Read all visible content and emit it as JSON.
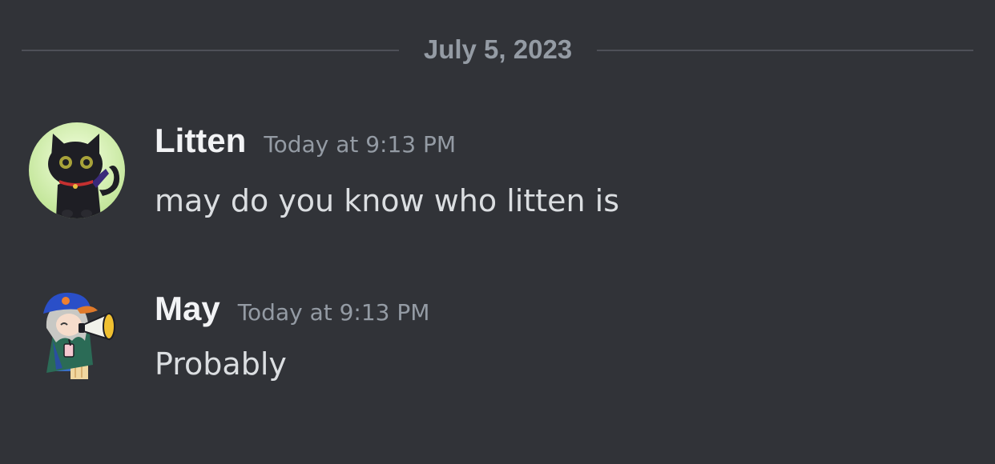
{
  "date_divider": {
    "label": "July 5, 2023"
  },
  "messages": [
    {
      "username": "Litten",
      "timestamp": "Today at 9:13 PM",
      "content": "may do you know who litten is",
      "avatar_icon": "black-cat-avatar"
    },
    {
      "username": "May",
      "timestamp": "Today at 9:13 PM",
      "content": "Probably",
      "avatar_icon": "megaphone-character-avatar"
    }
  ],
  "colors": {
    "background": "#313338",
    "divider": "#4e5058",
    "muted_text": "#949ba4",
    "username": "#f2f3f5",
    "message_text": "#dbdee1"
  }
}
